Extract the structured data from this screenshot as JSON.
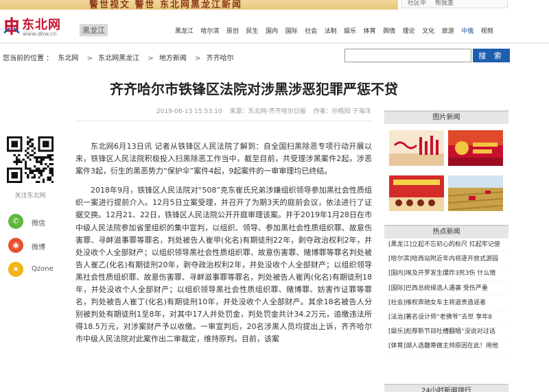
{
  "banner": {
    "ad_text": "警世视文 警世 东北网黑龙江新闻",
    "right_links": [
      "社区中",
      "帮我查"
    ]
  },
  "header": {
    "logo_text": "东北网",
    "logo_url": "www.dbw.cn",
    "region": "黑龙江",
    "nav": [
      "黑龙江",
      "哈尔滨",
      "原创",
      "民生",
      "国内",
      "国际",
      "社会",
      "法制",
      "娱乐",
      "体育",
      "舆情",
      "理论",
      "文化",
      "旅游",
      "中俄",
      "视频"
    ],
    "nav_active_index": 14
  },
  "breadcrumb": {
    "prefix": "您当前的位置 ：",
    "items": [
      "东北网",
      "东北网黑龙江",
      "地方新闻",
      "齐齐哈尔"
    ]
  },
  "search": {
    "placeholder": "",
    "button_label": "搜 索"
  },
  "article": {
    "title": "齐齐哈尔市铁锋区法院对涉黑涉恶犯罪严惩不贷",
    "time": "2019-06-13 15:53:10",
    "source": "来源：东北网-齐齐哈尔日报",
    "author": "作者：孙皓阳 于海洋",
    "paragraphs": [
      "东北网6月13日讯 记者从铁锋区人民法院了解到：自全国扫黑除恶专项行动开展以来，铁锋区人民法院积极投入扫黑除恶工作当中，截至目前，共受理涉黑案件2起，涉恶案件3起，衍生的黑恶势力“保护伞”案件4起，9起案件的一审审理均已终结。",
      "2018年9月，铁锋区人民法院对“508”克东崔氏兄弟涉嫌组织领导参加黑社会性质组织一案进行提前介入。12月5日立案受理，并召开了为期3天的庭前会议，依法进行了证据交换。12月21、22日，铁锋区人民法院公开开庭审理该案。并于2019年1月28日在市中级人民法院参加省里组织的集中宣判，以组织、领导、参加黑社会性质组织罪、故意伤害罪、寻衅滋事罪等罪名，判处被告人崔甲(化名)有期徒刑22年，剥夺政治权利2年，并处没收个人全部财产；以组织领导黑社会性质组织罪、故意伤害罪、赌博罪等罪名判处被告人崔乙(化名)有期徒刑20年，剥夺政治权利2年，并处没收个人全部财产；以组织领导黑社会性质组织罪、故意伤害罪、寻衅滋事罪等罪名，判处被告人崔丙(化名)有期徒刑18年，并处没收个人全部财产；以组织领导黑社会性质组织罪、赌博罪、妨害作证罪等罪名，判处被告人崔丁(化名)有期徒刑10年，并处没收个人全部财产。其余18名被告人分别被判处有期徒刑1至8年，对其中17人并处罚金，判处罚金共计34.2万元，追缴违法所得18.5万元，对涉案财产予以收缴。一审宣判后，20名涉黑人员均提出上诉，齐齐哈尔市中级人民法院对此案作出二审裁定，维持原判。目前，该案"
    ]
  },
  "share": {
    "qr_label": "关注东北网",
    "items": [
      {
        "label": "微信",
        "color": "#5fb840",
        "glyph": "✆"
      },
      {
        "label": "微博",
        "color": "#e6512d",
        "glyph": "◉"
      },
      {
        "label": "Qzone",
        "color": "#f3b415",
        "glyph": "★"
      }
    ]
  },
  "sidebar": {
    "pic_news_title": "图片新闻",
    "hot_news_title": "热点新闻",
    "rank_title": "24小时新闻排行",
    "hot_items": [
      {
        "tag": "[黑龙江]",
        "text": "立起不忘初心的标尺 扛起牢记使"
      },
      {
        "tag": "[哈尔滨]",
        "text": "哈西站附近年内将逐开放式游园"
      },
      {
        "tag": "[国内]",
        "text": "埃及开罗发生爆炸3死3伤 什么情"
      },
      {
        "tag": "[国际]",
        "text": "巴西总统候选人遇袭 受伤严重"
      },
      {
        "tag": "[社会]",
        "text": "维权奔驰女车主将追责造谣者"
      },
      {
        "tag": "[法治]",
        "text": "著名设计师“老佛爷”去世 享年8"
      },
      {
        "tag": "[娱乐]",
        "text": "彪荐新节目吐槽翻唱“没说对过话"
      },
      {
        "tag": "[体育]",
        "text": "湖人选馥蒂做主帅原因在此！用他"
      }
    ]
  },
  "colors": {
    "brand_red": "#c8102e",
    "search_blue": "#1d5fae",
    "nav_active": "#1e4e8f"
  }
}
